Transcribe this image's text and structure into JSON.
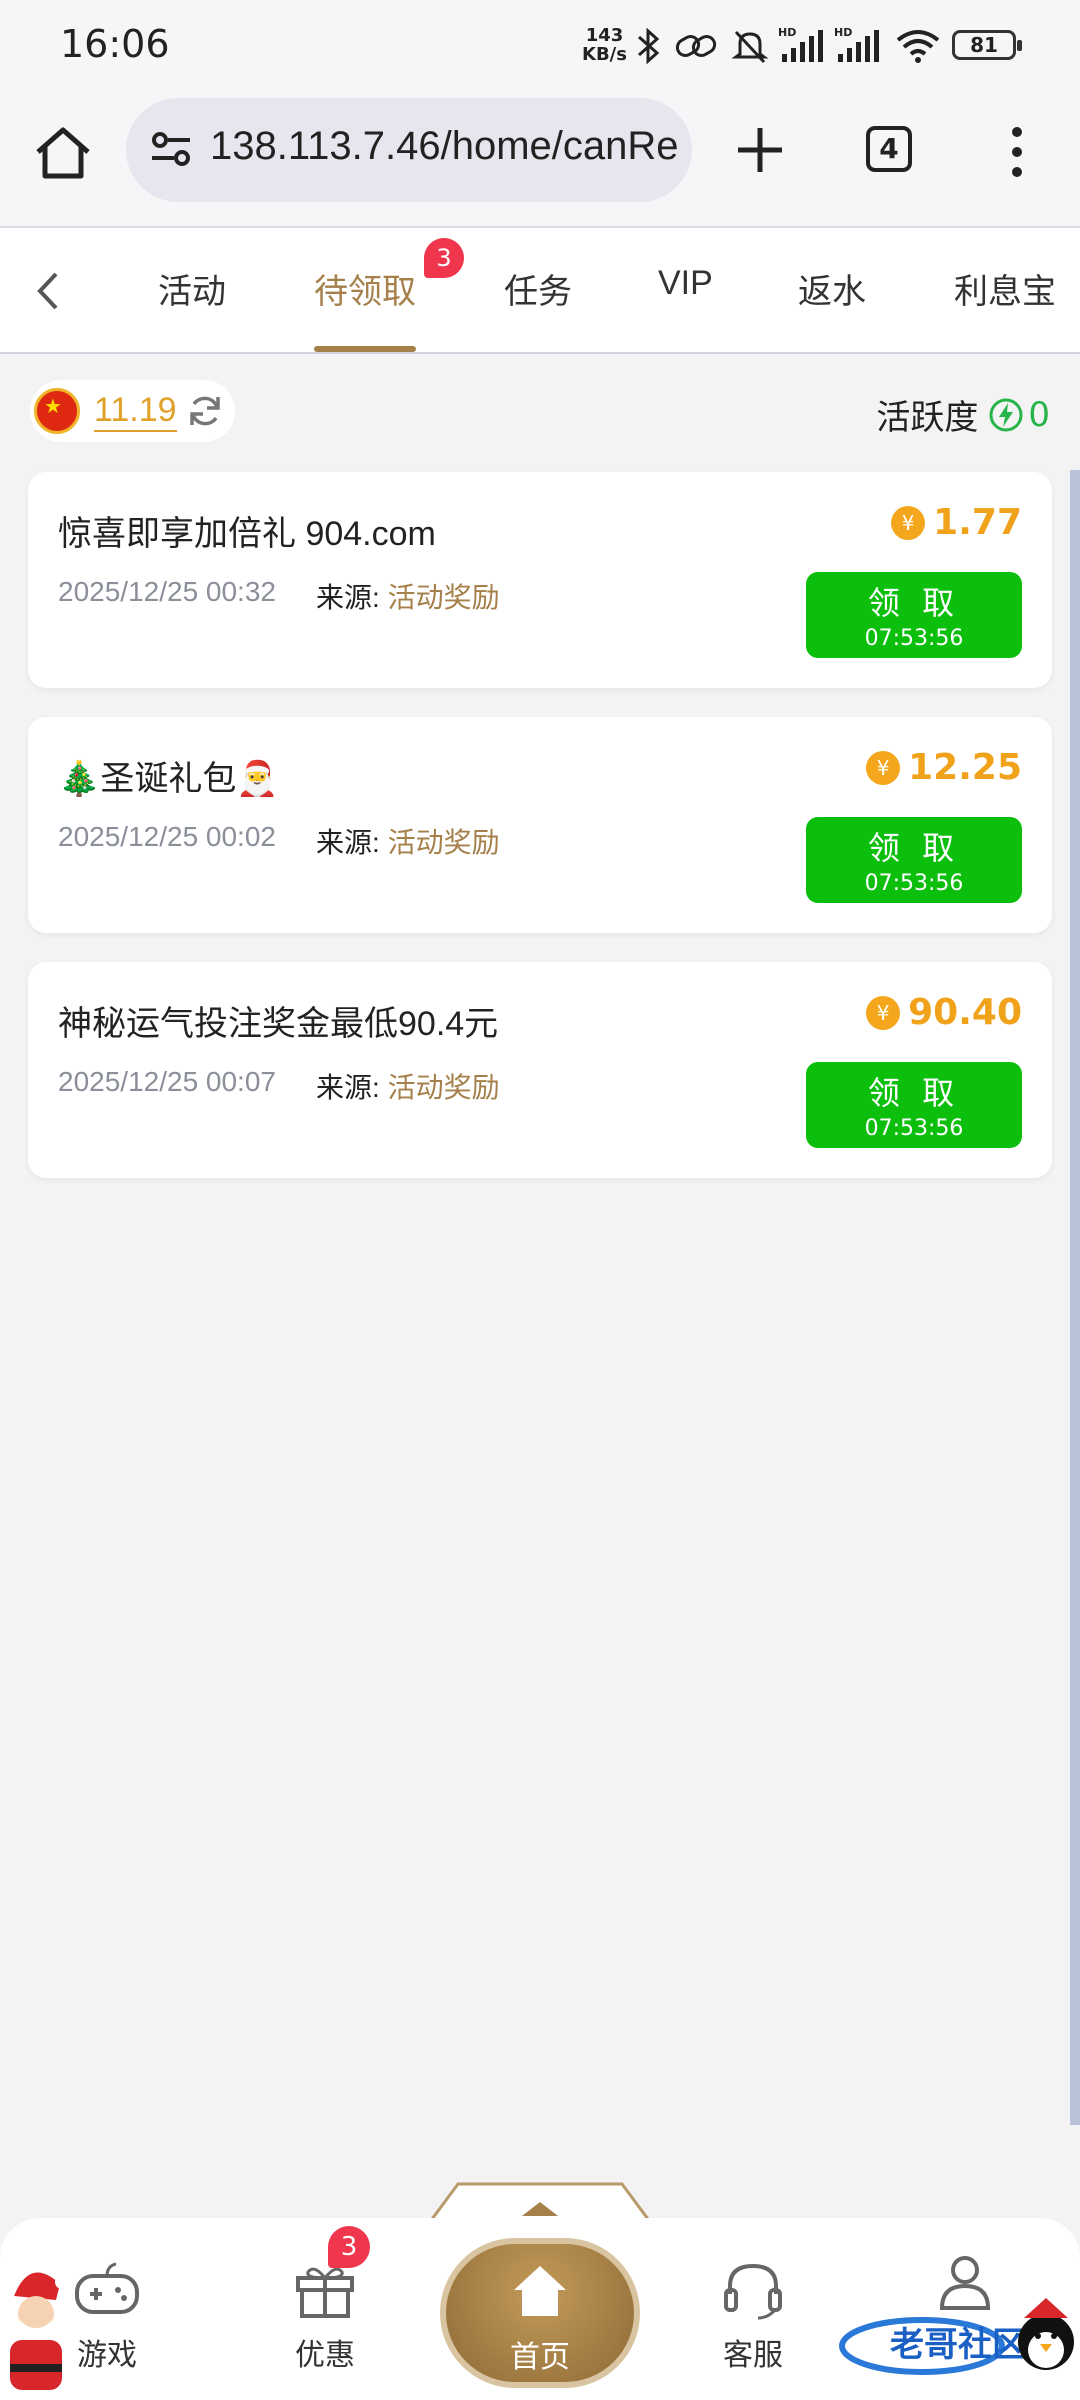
{
  "status_bar": {
    "time": "16:06",
    "net_speed_top": "143",
    "net_speed_bottom": "KB/s",
    "battery": "81"
  },
  "browser": {
    "url": "138.113.7.46/home/canRe",
    "tab_count": "4"
  },
  "tabs": [
    {
      "label": "活动"
    },
    {
      "label": "待领取",
      "badge": "3",
      "active": true
    },
    {
      "label": "任务"
    },
    {
      "label": "VIP"
    },
    {
      "label": "返水"
    },
    {
      "label": "利息宝"
    }
  ],
  "balance": {
    "amount": "11.19"
  },
  "activity": {
    "label": "活跃度",
    "value": "0"
  },
  "rewards": [
    {
      "title": "惊喜即享加倍礼 904.com",
      "date": "2025/12/25 00:32",
      "source_label": "来源:",
      "source": "活动奖励",
      "amount": "1.77",
      "claim_label": "领 取",
      "countdown": "07:53:56"
    },
    {
      "title": "🎄圣诞礼包🎅",
      "date": "2025/12/25 00:02",
      "source_label": "来源:",
      "source": "活动奖励",
      "amount": "12.25",
      "claim_label": "领 取",
      "countdown": "07:53:56"
    },
    {
      "title": "神秘运气投注奖金最低90.4元",
      "date": "2025/12/25 00:07",
      "source_label": "来源:",
      "source": "活动奖励",
      "amount": "90.40",
      "claim_label": "领 取",
      "countdown": "07:53:56"
    }
  ],
  "bottom_nav": {
    "games": "游戏",
    "offers": "优惠",
    "offers_badge": "3",
    "home": "首页",
    "service": "客服",
    "profile": ""
  },
  "watermark": "老哥社区",
  "colors": {
    "accent": "#a5804a",
    "claim": "#0cbf0c",
    "badge": "#f0364d",
    "gold": "#f1a21b"
  }
}
